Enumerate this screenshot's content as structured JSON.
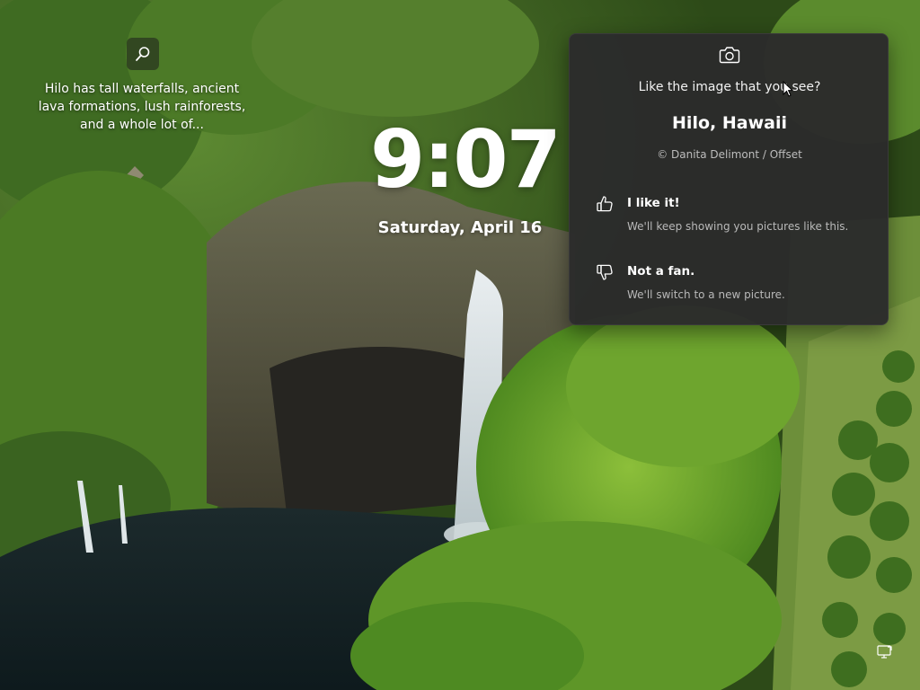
{
  "search": {
    "icon": "search-icon",
    "caption": "Hilo has tall waterfalls, ancient lava formations, lush rainforests, and a whole lot of..."
  },
  "clock": {
    "time": "9:07",
    "date": "Saturday, April 16"
  },
  "spotlight": {
    "icon": "camera-icon",
    "prompt": "Like the image that you see?",
    "location": "Hilo, Hawaii",
    "credit": "© Danita Delimont / Offset",
    "options": [
      {
        "icon": "thumbs-up-icon",
        "title": "I like it!",
        "subtitle": "We'll keep showing you pictures like this."
      },
      {
        "icon": "thumbs-down-icon",
        "title": "Not a fan.",
        "subtitle": "We'll switch to a new picture."
      }
    ]
  },
  "status": {
    "icon": "network-icon"
  },
  "colors": {
    "flyout_bg": "#2b2b2b",
    "text_primary": "#ffffff",
    "text_secondary": "#b9b9b9"
  }
}
